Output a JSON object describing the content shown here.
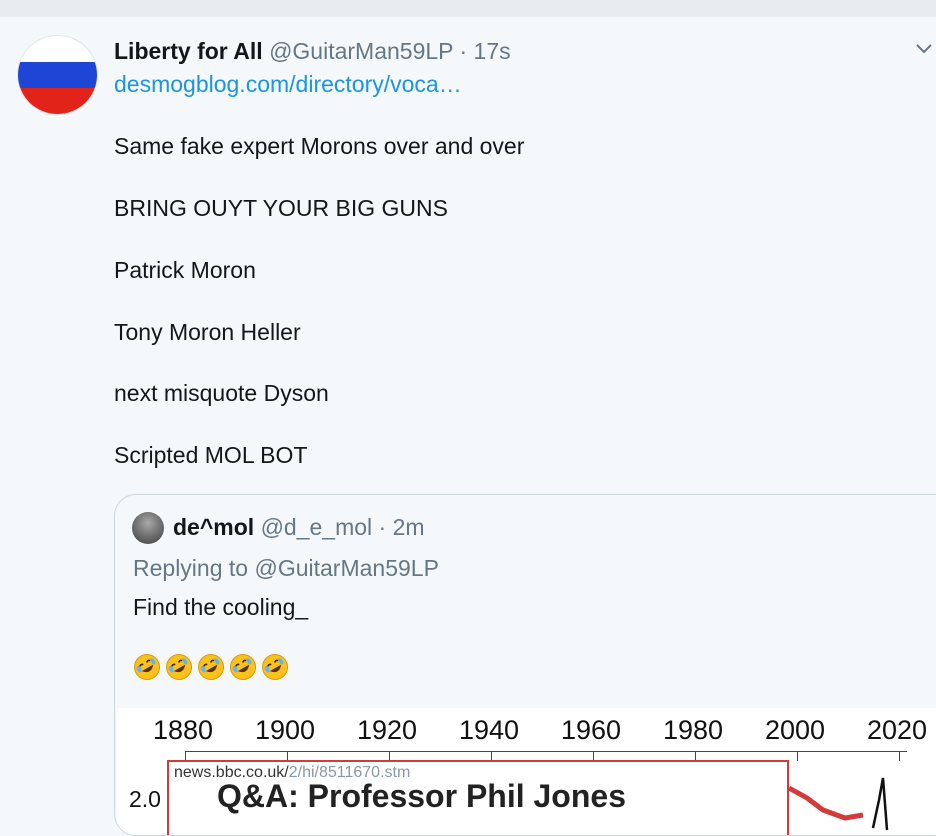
{
  "tweet": {
    "author_name": "Liberty for All",
    "handle": "@GuitarMan59LP",
    "separator": "·",
    "time": "17s",
    "link": "desmogblog.com/directory/voca…",
    "paragraphs": [
      "Same fake expert Morons over and over",
      "BRING OUYT YOUR BIG GUNS",
      "Patrick Moron",
      "Tony Moron Heller",
      "next misquote Dyson",
      "Scripted MOL BOT"
    ],
    "avatar_colors": [
      "#ffffff",
      "#1f45d6",
      "#e2231a"
    ]
  },
  "quoted": {
    "author_name": "de^mol",
    "handle": "@d_e_mol",
    "separator": "·",
    "time": "2m",
    "replying_prefix": "Replying to",
    "replying_to": "@GuitarMan59LP",
    "text": "Find the cooling_",
    "emoji_icon": "rolling-on-floor-laughing-icon",
    "emoji_count": 5,
    "image": {
      "years": [
        "1880",
        "1900",
        "1920",
        "1940",
        "1960",
        "1980",
        "2000",
        "2020"
      ],
      "y_tick": "2.0",
      "url_main": "news.bbc.co.uk/",
      "url_rest": "2/hi/8511670.stm",
      "headline": "Q&A: Professor Phil Jones"
    }
  },
  "colors": {
    "link": "#1b95e0",
    "muted": "#657786",
    "border": "#ccd6dd"
  }
}
